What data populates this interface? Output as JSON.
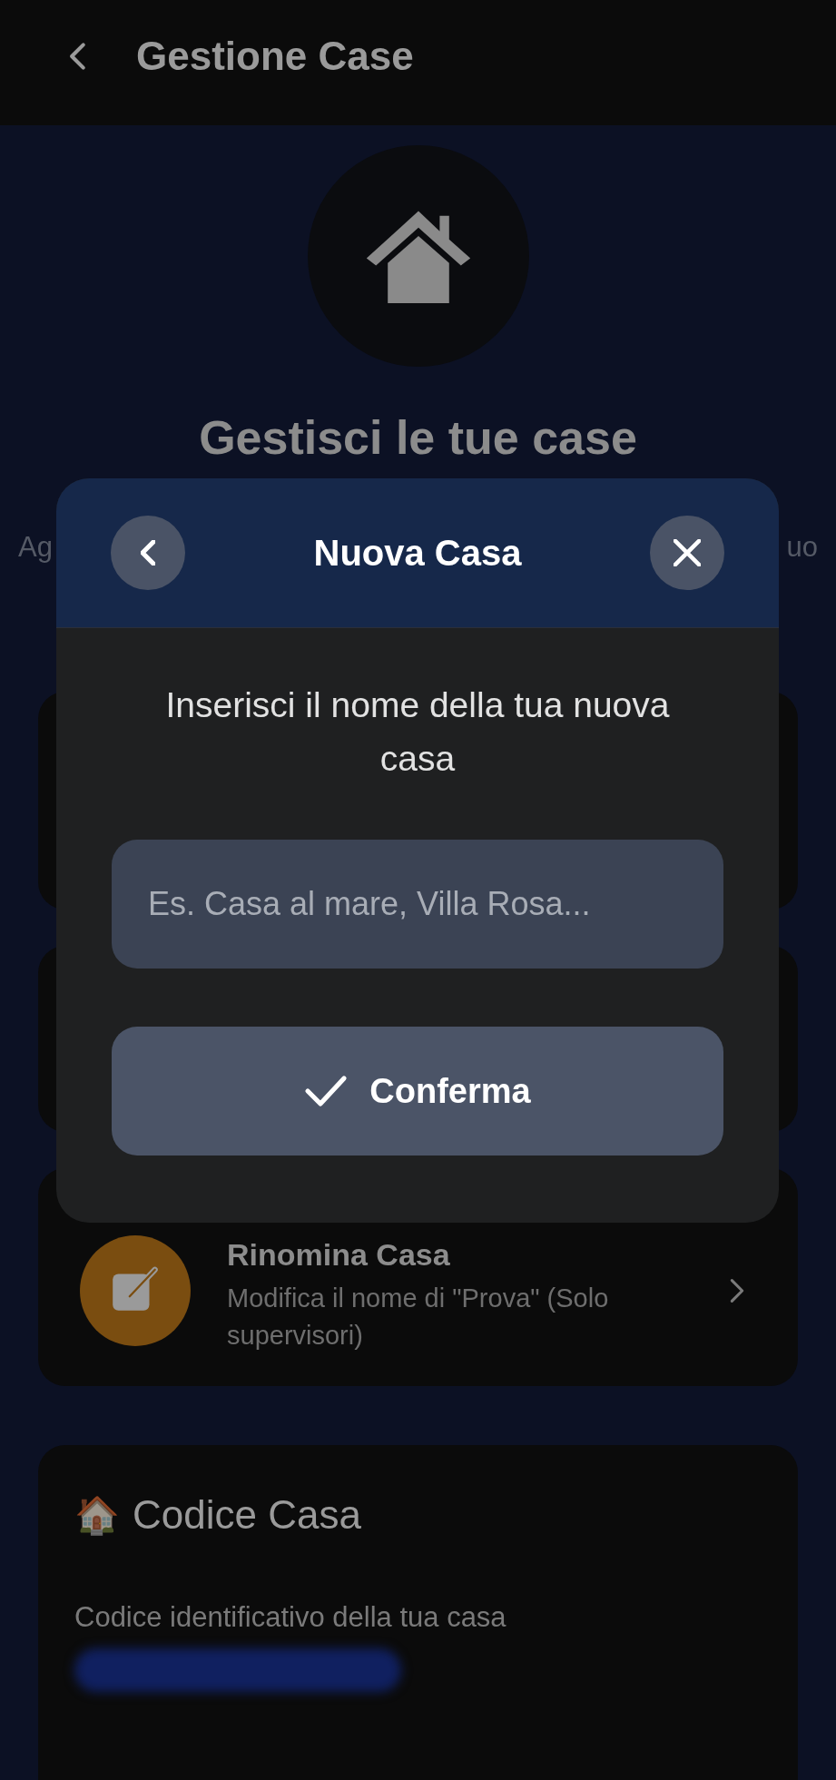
{
  "header": {
    "title": "Gestione Case"
  },
  "hero": {
    "title": "Gestisci le tue case",
    "subtitle_fragments": [
      "Ag",
      "uo"
    ]
  },
  "action_cards": [
    {
      "title": "Rinomina Casa",
      "description": "Modifica il nome di \"Prova\" (Solo supervisori)",
      "color": "#7a4d10"
    }
  ],
  "code_card": {
    "emoji": "🏠",
    "title": "Codice Casa",
    "label": "Codice identificativo della tua casa"
  },
  "dialog": {
    "title": "Nuova Casa",
    "prompt": "Inserisci il nome della tua nuova casa",
    "input": {
      "placeholder": "Es. Casa al mare, Villa Rosa..."
    },
    "confirm_button": "Conferma"
  }
}
